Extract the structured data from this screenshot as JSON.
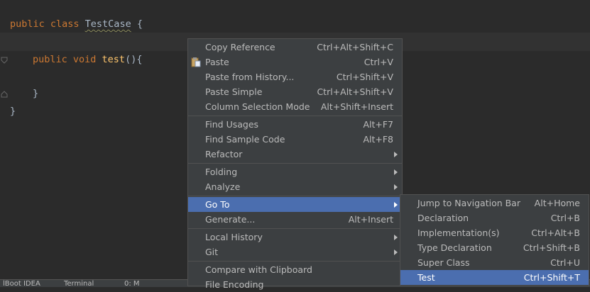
{
  "editor": {
    "lines": [
      {
        "kw": "public class ",
        "cls": "TestCase",
        "rest": " {"
      },
      {
        "kw": "public void ",
        "fn": "test",
        "rest": "(){"
      },
      {
        "rest": "}"
      },
      {
        "rest": "}"
      }
    ]
  },
  "context_menu": {
    "items": [
      {
        "label": "Copy Reference",
        "shortcut": "Ctrl+Alt+Shift+C"
      },
      {
        "label": "Paste",
        "shortcut": "Ctrl+V",
        "icon": "clipboard-icon"
      },
      {
        "label": "Paste from History...",
        "shortcut": "Ctrl+Shift+V"
      },
      {
        "label": "Paste Simple",
        "shortcut": "Ctrl+Alt+Shift+V"
      },
      {
        "label": "Column Selection Mode",
        "shortcut": "Alt+Shift+Insert"
      },
      {
        "label": "Find Usages",
        "shortcut": "Alt+F7"
      },
      {
        "label": "Find Sample Code",
        "shortcut": "Alt+F8"
      },
      {
        "label": "Refactor",
        "shortcut": ""
      },
      {
        "label": "Folding",
        "shortcut": ""
      },
      {
        "label": "Analyze",
        "shortcut": ""
      },
      {
        "label": "Go To",
        "shortcut": ""
      },
      {
        "label": "Generate...",
        "shortcut": "Alt+Insert"
      },
      {
        "label": "Local History",
        "shortcut": ""
      },
      {
        "label": "Git",
        "shortcut": ""
      },
      {
        "label": "Compare with Clipboard",
        "shortcut": ""
      },
      {
        "label": "File Encoding",
        "shortcut": ""
      }
    ]
  },
  "goto_submenu": {
    "items": [
      {
        "label": "Jump to Navigation Bar",
        "shortcut": "Alt+Home"
      },
      {
        "label": "Declaration",
        "shortcut": "Ctrl+B"
      },
      {
        "label": "Implementation(s)",
        "shortcut": "Ctrl+Alt+B"
      },
      {
        "label": "Type Declaration",
        "shortcut": "Ctrl+Shift+B"
      },
      {
        "label": "Super Class",
        "shortcut": "Ctrl+U"
      },
      {
        "label": "Test",
        "shortcut": "Ctrl+Shift+T"
      }
    ]
  },
  "statusbar": {
    "left": "lBoot IDEA",
    "terminal": "Terminal",
    "other": "0: M"
  },
  "colors": {
    "background": "#2b2b2b",
    "menu_bg": "#3c3f41",
    "selection": "#4b6eaf",
    "keyword": "#cc7832",
    "function": "#ffc66d"
  }
}
